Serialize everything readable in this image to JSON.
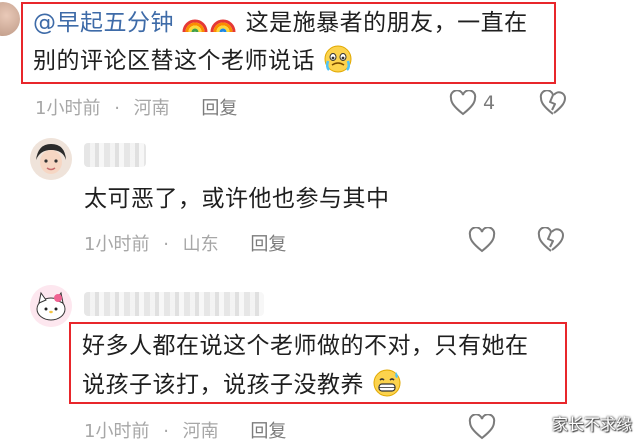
{
  "comments": [
    {
      "mention": "@早起五分钟",
      "line1_rest": " 这是施暴者的朋友，一直在",
      "line2": "别的评论区替这个老师说话",
      "time": "1小时前",
      "location": "河南",
      "reply_label": "回复",
      "like_count": "4"
    },
    {
      "text": "太可恶了，或许他也参与其中",
      "time": "1小时前",
      "location": "山东",
      "reply_label": "回复"
    },
    {
      "line1": "好多人都在说这个老师做的不对，只有她在",
      "line2": "说孩子该打，说孩子没教养",
      "time": "1小时前",
      "location": "河南",
      "reply_label": "回复"
    }
  ],
  "separator": "·",
  "watermark": "家长不求缘",
  "colors": {
    "highlight": "#e8262b",
    "mention": "#3e6ba8",
    "meta": "#a7a7a7"
  }
}
